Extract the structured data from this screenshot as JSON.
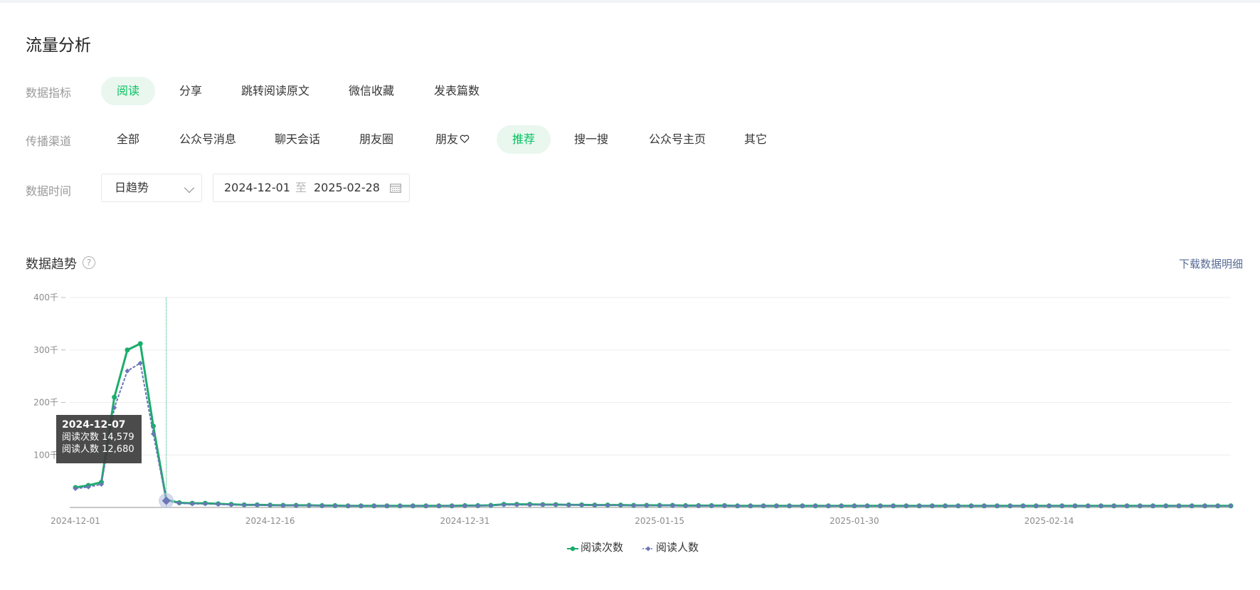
{
  "page": {
    "title": "流量分析"
  },
  "filters": {
    "metric_label": "数据指标",
    "metrics": [
      "阅读",
      "分享",
      "跳转阅读原文",
      "微信收藏",
      "发表篇数"
    ],
    "channel_label": "传播渠道",
    "channels": [
      "全部",
      "公众号消息",
      "聊天会话",
      "朋友圈",
      "朋友",
      "推荐",
      "搜一搜",
      "公众号主页",
      "其它"
    ],
    "time_label": "数据时间",
    "granularity": "日趋势",
    "date_start": "2024-12-01",
    "date_sep": "至",
    "date_end": "2025-02-28"
  },
  "trend": {
    "title": "数据趋势",
    "help_icon": "question-circle-icon",
    "help_glyph": "?",
    "download_label": "下载数据明细"
  },
  "tooltip": {
    "date": "2024-12-07",
    "line1": "阅读次数 14,579",
    "line2": "阅读人数 12,680"
  },
  "colors": {
    "accent": "#07c160",
    "series1": "#1aad6b",
    "series2": "#6a76b8",
    "link": "#576b95"
  },
  "chart_data": {
    "type": "line",
    "x_start": "2024-12-01",
    "x_end": "2025-02-28",
    "x_ticks": [
      "2024-12-01",
      "2024-12-16",
      "2024-12-31",
      "2025-01-15",
      "2025-01-30",
      "2025-02-14"
    ],
    "y_ticks": [
      "400千",
      "300千",
      "200千",
      "100千"
    ],
    "ylim": [
      0,
      400000
    ],
    "grid": true,
    "legend_position": "bottom-center",
    "series": [
      {
        "name": "阅读次数",
        "color": "#1aad6b",
        "values": [
          38000,
          42000,
          48000,
          210000,
          300000,
          312000,
          155000,
          14579,
          9000,
          8000,
          8000,
          7000,
          6000,
          5000,
          5000,
          4500,
          4000,
          4000,
          4000,
          3500,
          3500,
          3000,
          3000,
          3000,
          3000,
          3000,
          3000,
          3000,
          3000,
          3000,
          3500,
          3500,
          4000,
          6000,
          6000,
          6000,
          5500,
          5500,
          5000,
          5000,
          4500,
          4500,
          4500,
          4000,
          4000,
          4000,
          4000,
          3500,
          3500,
          3500,
          3500,
          3000,
          3000,
          3000,
          3000,
          3000,
          3000,
          3000,
          3000,
          3000,
          3000,
          3000,
          3000,
          3000,
          3000,
          3000,
          3000,
          3000,
          3000,
          3000,
          3000,
          3000,
          3000,
          3000,
          3000,
          3000,
          3000,
          3000,
          3000,
          3000,
          3000,
          3000,
          3000,
          3000,
          3000,
          3000,
          3000,
          3000,
          3000,
          3000
        ]
      },
      {
        "name": "阅读人数",
        "color": "#6a76b8",
        "values": [
          36000,
          39000,
          44000,
          190000,
          260000,
          275000,
          140000,
          12680,
          8000,
          7000,
          7000,
          6000,
          5000,
          4500,
          4500,
          4000,
          3500,
          3500,
          3500,
          3000,
          3000,
          2800,
          2800,
          2800,
          2800,
          2800,
          2800,
          2800,
          2800,
          2800,
          3000,
          3000,
          3500,
          5000,
          5000,
          5000,
          5000,
          5000,
          4500,
          4500,
          4000,
          4000,
          4000,
          3500,
          3500,
          3500,
          3500,
          3000,
          3000,
          3000,
          3000,
          2800,
          2800,
          2800,
          2800,
          2800,
          2800,
          2800,
          2800,
          2800,
          2800,
          2800,
          2800,
          2800,
          2800,
          2800,
          2800,
          2800,
          2800,
          2800,
          2800,
          2800,
          2800,
          2800,
          2800,
          2800,
          2800,
          2800,
          2800,
          2800,
          2800,
          2800,
          2800,
          2800,
          2800,
          2800,
          2800,
          2800,
          2800,
          2800
        ]
      }
    ],
    "highlight_index": 7
  }
}
